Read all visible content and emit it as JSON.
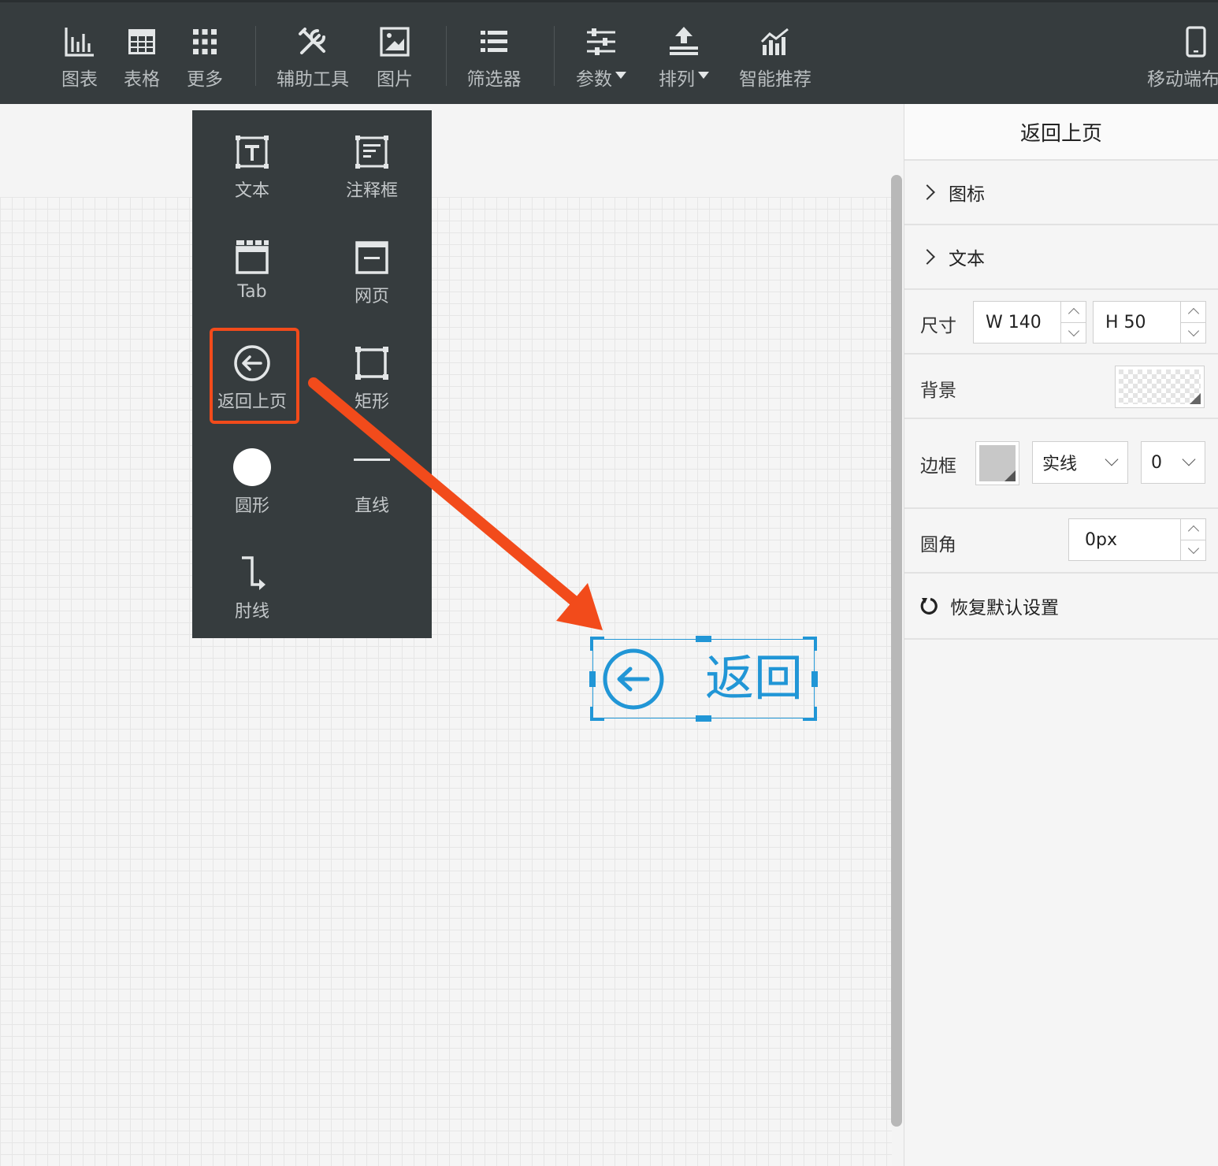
{
  "toolbar": {
    "items": [
      {
        "label": "图表",
        "icon": "bar-chart-icon"
      },
      {
        "label": "表格",
        "icon": "table-icon"
      },
      {
        "label": "更多",
        "icon": "grid-dots-icon"
      },
      {
        "label": "辅助工具",
        "icon": "tools-icon"
      },
      {
        "label": "图片",
        "icon": "image-icon"
      },
      {
        "label": "筛选器",
        "icon": "list-icon"
      },
      {
        "label": "参数",
        "icon": "sliders-icon"
      },
      {
        "label": "排列",
        "icon": "arrange-icon"
      },
      {
        "label": "智能推荐",
        "icon": "trend-chart-icon"
      },
      {
        "label": "移动端布",
        "icon": "mobile-icon"
      }
    ]
  },
  "more_panel": {
    "items": [
      {
        "label": "文本",
        "icon": "text-box-icon"
      },
      {
        "label": "注释框",
        "icon": "annotation-icon"
      },
      {
        "label": "Tab",
        "icon": "tab-icon"
      },
      {
        "label": "网页",
        "icon": "webpage-icon"
      },
      {
        "label": "返回上页",
        "icon": "back-arrow-circle-icon"
      },
      {
        "label": "矩形",
        "icon": "rectangle-icon"
      },
      {
        "label": "圆形",
        "icon": "circle-icon"
      },
      {
        "label": "直线",
        "icon": "line-icon"
      },
      {
        "label": "肘线",
        "icon": "elbow-line-icon"
      }
    ],
    "highlight_color": "#f24b1b"
  },
  "widget": {
    "text": "返回",
    "color": "#2196d6"
  },
  "props": {
    "title": "返回上页",
    "sections": {
      "icon": "图标",
      "text": "文本"
    },
    "size": {
      "label": "尺寸",
      "width": "W 140",
      "height": "H 50"
    },
    "background": {
      "label": "背景"
    },
    "border": {
      "label": "边框",
      "style": "实线",
      "width": "0"
    },
    "radius": {
      "label": "圆角",
      "value": "0px"
    },
    "reset": "恢复默认设置"
  }
}
